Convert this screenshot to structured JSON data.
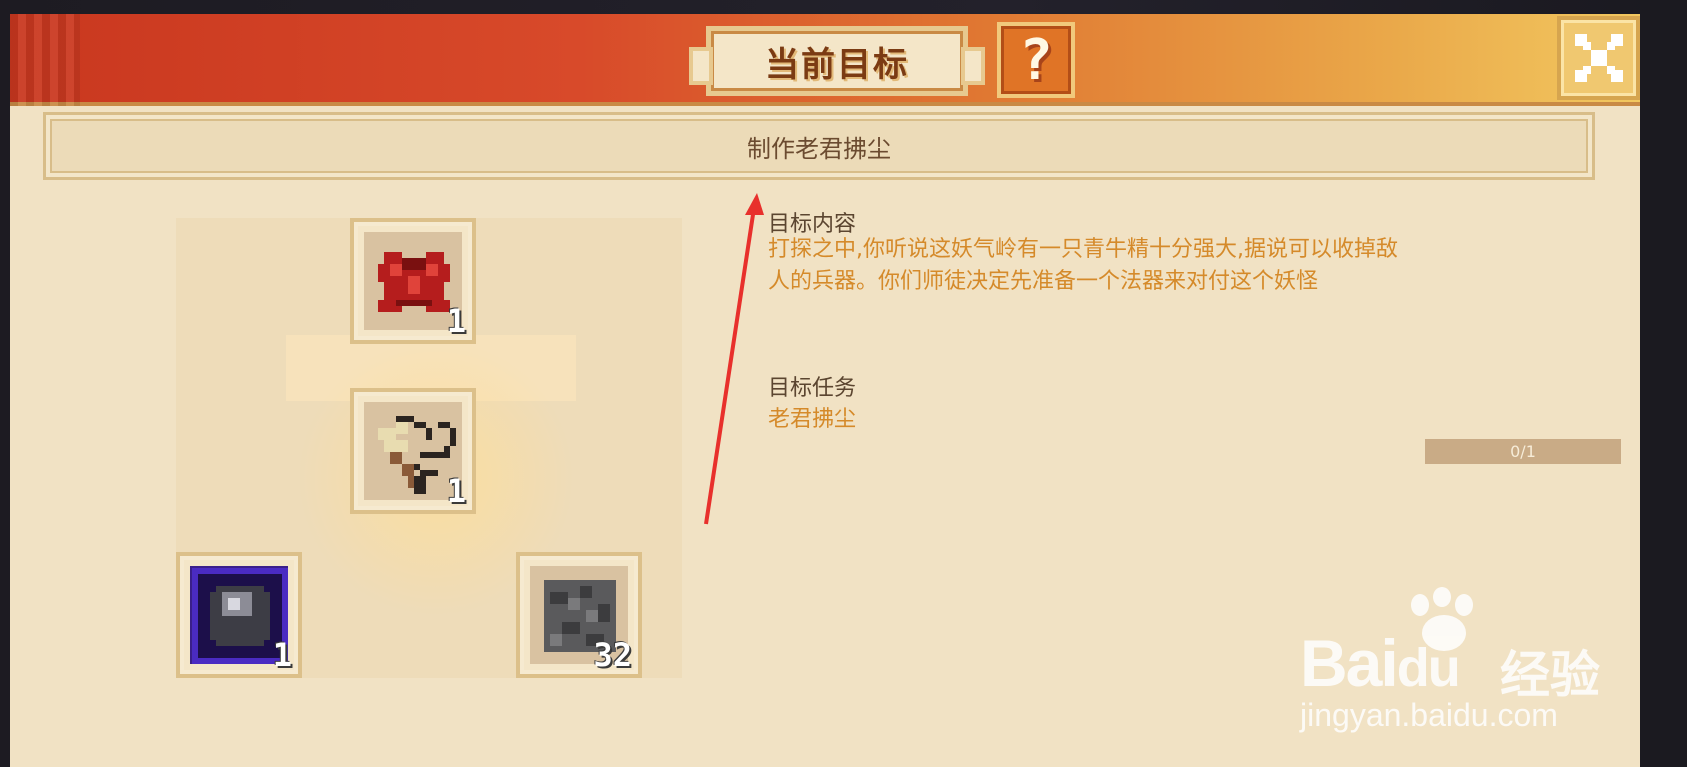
{
  "header": {
    "title": "当前目标",
    "help_label": "?",
    "close_icon": "close-x-icon",
    "accent_color": "#d84a2a"
  },
  "goal": {
    "text": "制作老君拂尘"
  },
  "recipe": {
    "result": {
      "icon": "horsetail-whisk-icon",
      "count": "1"
    },
    "inputs": [
      {
        "icon": "red-cloth-icon",
        "count": "1"
      },
      {
        "icon": "dark-orb-icon",
        "count": "1"
      },
      {
        "icon": "cobblestone-icon",
        "count": "32"
      }
    ]
  },
  "info": {
    "content_label": "目标内容",
    "content_lines": [
      "打探之中,你听说这妖气岭有一只青牛精十分强大,据说可以收掉敌",
      "人的兵器。你们师徒决定先准备一个法器来对付这个妖怪"
    ],
    "task_label": "目标任务",
    "task_name": "老君拂尘",
    "task_progress": "0/1",
    "task_progress_fraction": 0
  },
  "watermark": {
    "brand": "Bai",
    "brand_suffix": "du",
    "jingyan": "经验",
    "url": "jingyan.baidu.com"
  }
}
